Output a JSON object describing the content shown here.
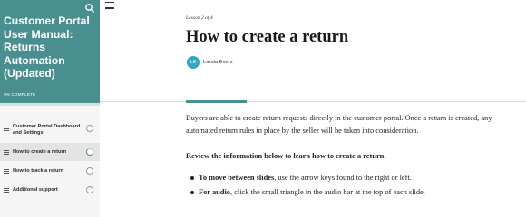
{
  "sidebar": {
    "course_title": "Customer Portal User Manual: Returns Automation (Updated)",
    "progress_label": "0% COMPLETE",
    "progress_value": 0,
    "lessons": [
      {
        "label": "Customer Portal Dashboard and Settings",
        "active": false
      },
      {
        "label": "How to create a return",
        "active": true
      },
      {
        "label": "How to track a return",
        "active": false
      },
      {
        "label": "Additional support",
        "active": false
      }
    ]
  },
  "lesson": {
    "number_label": "Lesson 2 of 4",
    "title": "How to create a return",
    "author_initials": "LE",
    "author_name": "Landa Evers"
  },
  "content": {
    "paragraph1": "Buyers are able to create return requests directly in the customer portal. Once a return is created, any automated return rules in place by the seller will be taken into consideration.",
    "paragraph2": "Review the information below to learn how to create a return.",
    "bullets": [
      {
        "bold": "To move between slides",
        "text": ", use the arrow keys found to the right or left."
      },
      {
        "bold": "For audio",
        "text": ", click the small triangle in the audio bar at the top of each slide."
      }
    ]
  },
  "colors": {
    "accent": "#4a8f8f",
    "avatar": "#2fa6c4"
  },
  "icons": {
    "search": "search-icon",
    "menu": "hamburger-menu-icon",
    "lesson_type": "text-lines-icon",
    "status": "status-circle-icon"
  }
}
